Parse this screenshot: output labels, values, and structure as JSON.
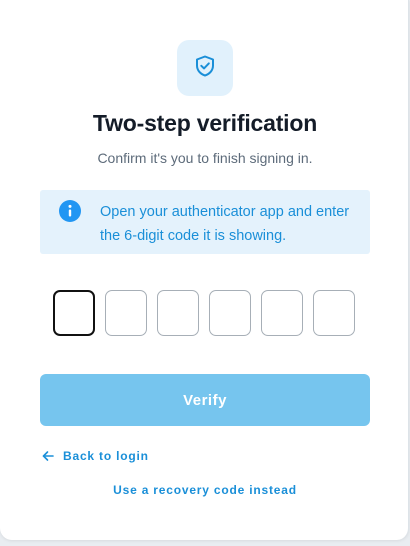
{
  "header": {
    "icon": "shield-check-icon",
    "title": "Two-step verification",
    "subtitle": "Confirm it's you to finish signing in."
  },
  "info": {
    "icon": "info-icon",
    "text": "Open your authenticator app and enter the 6-digit code it is showing."
  },
  "code": {
    "digits": [
      "",
      "",
      "",
      "",
      "",
      ""
    ],
    "active_index": 0
  },
  "actions": {
    "verify_label": "Verify",
    "back_label": "Back to login",
    "back_icon": "arrow-left-icon",
    "recovery_label": "Use a recovery code instead"
  },
  "colors": {
    "accent": "#1a8fd8",
    "button_disabled": "#76c5ee",
    "info_bg": "#e4f2fc",
    "title": "#141c28"
  }
}
